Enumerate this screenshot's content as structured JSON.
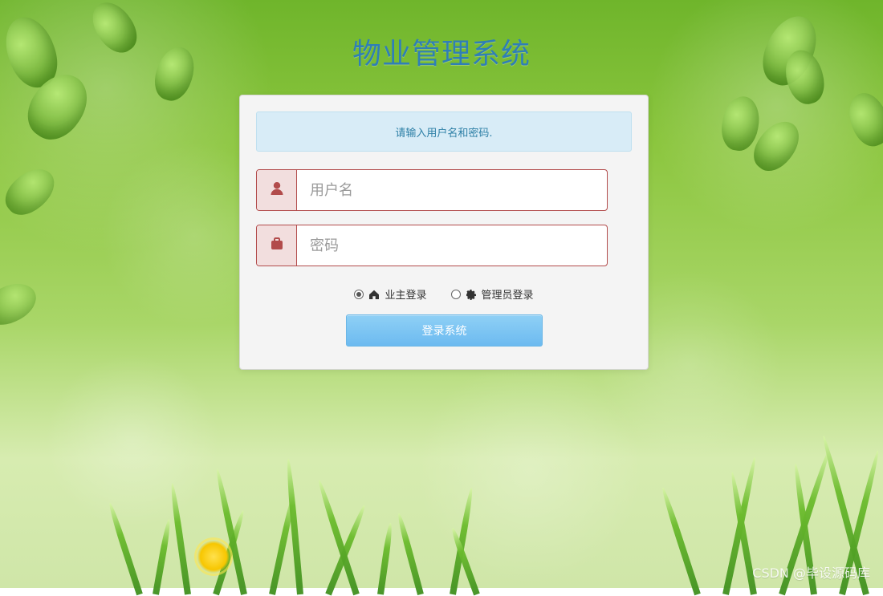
{
  "page": {
    "title": "物业管理系统",
    "notice": "请输入用户名和密码.",
    "username_placeholder": "用户名",
    "password_placeholder": "密码",
    "radio_options": [
      {
        "label": "业主登录",
        "selected": true,
        "icon": "home-icon"
      },
      {
        "label": "管理员登录",
        "selected": false,
        "icon": "gear-icon"
      }
    ],
    "login_button_label": "登录系统",
    "watermark": "CSDN @毕设源码库"
  },
  "theme": {
    "title_color": "#2f7fb6",
    "notice_bg": "#d8ecf7",
    "notice_text": "#2d7fa6",
    "field_border": "#b24b4b",
    "addon_bg": "#f2dede",
    "button_bg": "#6cbaf0"
  }
}
